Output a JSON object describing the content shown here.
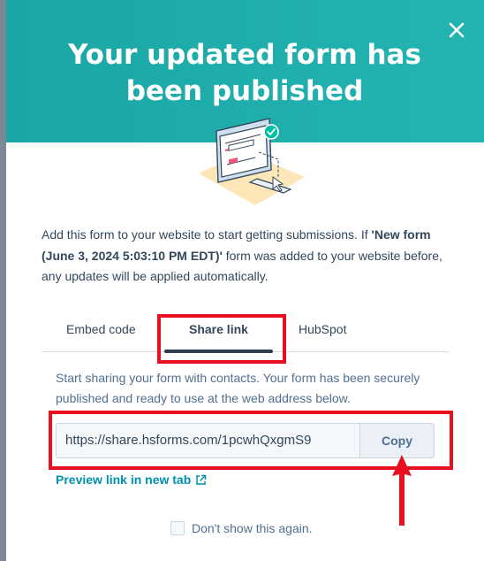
{
  "header": {
    "title": "Your updated form has been published"
  },
  "intro": {
    "text_before": "Add this form to your website to start getting submissions. If ",
    "form_name": "'New form (June 3, 2024 5:03:10 PM EDT)'",
    "text_after": " form was added to your website before, any updates will be applied automatically."
  },
  "tabs": [
    {
      "label": "Embed code",
      "selected": false
    },
    {
      "label": "Share link",
      "selected": true
    },
    {
      "label": "HubSpot",
      "selected": false
    }
  ],
  "share": {
    "description": "Start sharing your form with contacts. Your form has been securely published and ready to use at the web address below.",
    "url": "https://share.hsforms.com/1pcwhQxgmS9",
    "copy_label": "Copy",
    "preview_label": "Preview link in new tab"
  },
  "footer": {
    "dont_show_label": "Don't show this again."
  },
  "colors": {
    "header_bg": "#1aa7a5",
    "highlight_red": "#e8101f",
    "link": "#0091ae"
  }
}
